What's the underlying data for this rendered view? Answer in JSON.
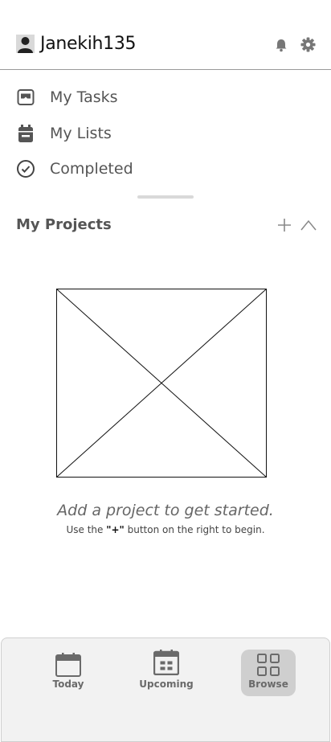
{
  "header": {
    "username": "Janekih135",
    "icons": {
      "avatar": "person-icon",
      "notifications": "bell-icon",
      "settings": "gear-icon"
    }
  },
  "menu": {
    "items": [
      {
        "label": "My Tasks",
        "icon": "inbox-icon"
      },
      {
        "label": "My Lists",
        "icon": "calendar-list-icon"
      },
      {
        "label": "Completed",
        "icon": "check-circle-icon"
      }
    ]
  },
  "projects": {
    "title": "My Projects",
    "add_icon": "plus-icon",
    "collapse_icon": "chevron-up-icon",
    "empty_title": "Add a project to get started.",
    "empty_sub_before": "Use the ",
    "empty_sub_plus": "\"+\"",
    "empty_sub_after": " button on the right to begin."
  },
  "bottom_nav": {
    "items": [
      {
        "label": "Today",
        "icon": "calendar-icon",
        "active": false
      },
      {
        "label": "Upcoming",
        "icon": "calendar-grid-icon",
        "active": false
      },
      {
        "label": "Browse",
        "icon": "grid-icon",
        "active": true
      }
    ]
  },
  "colors": {
    "text": "#4a4a4a",
    "active_tab_bg": "#cfcfcf",
    "nav_bg": "#f2f2f2"
  }
}
